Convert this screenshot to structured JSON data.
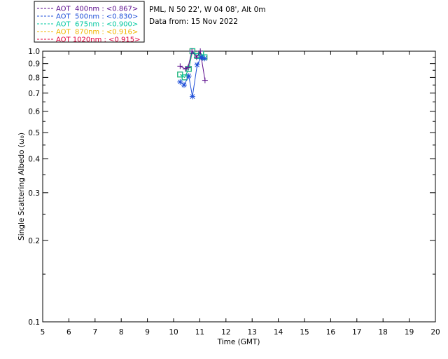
{
  "header": {
    "site_line": "PML, N 50 22', W 04 08', Alt 0m",
    "date_line": "Data from: 15 Nov 2022"
  },
  "chart_data": {
    "type": "scatter",
    "xlabel": "Time (GMT)",
    "ylabel": "Single Scattering Albedo (ω₀)",
    "xlim": [
      5,
      20
    ],
    "ylim": [
      0.1,
      1.0
    ],
    "yscale": "log",
    "x_ticks": [
      5,
      6,
      7,
      8,
      9,
      10,
      11,
      12,
      13,
      14,
      15,
      16,
      17,
      18,
      19,
      20
    ],
    "y_ticks": [
      0.1,
      0.2,
      0.3,
      0.4,
      0.5,
      0.6,
      0.7,
      0.8,
      0.9,
      1.0
    ],
    "y_tick_labels": [
      "0.1",
      "0.2",
      "0.3",
      "0.4",
      "0.5",
      "0.6",
      "0.7",
      "0.8",
      "0.9",
      "1.0"
    ],
    "legend_position": "top-left, outside plot",
    "series": [
      {
        "name": "AOT  400nm : <0.867>",
        "color": "#5a0a8c",
        "marker": "plus",
        "x": [
          10.25,
          10.45,
          10.55,
          10.7,
          10.88,
          11.02,
          11.2
        ],
        "y": [
          0.88,
          0.86,
          0.87,
          1.0,
          0.95,
          1.0,
          0.78
        ]
      },
      {
        "name": "AOT  500nm : <0.830>",
        "color": "#1f4fd8",
        "marker": "star",
        "x": [
          10.25,
          10.4,
          10.58,
          10.72,
          10.9,
          11.05,
          11.18
        ],
        "y": [
          0.77,
          0.75,
          0.81,
          0.68,
          0.89,
          0.95,
          0.94
        ]
      },
      {
        "name": "AOT  675nm : <0.900>",
        "color": "#00c8a0",
        "marker": "square",
        "x": [
          10.25,
          10.42,
          10.58,
          10.72,
          10.9,
          11.05,
          11.18
        ],
        "y": [
          0.82,
          0.8,
          0.86,
          1.0,
          0.96,
          0.98,
          0.95
        ]
      },
      {
        "name": "AOT  870nm : <0.916>",
        "color": "#f0b400",
        "marker": "square",
        "x": [
          10.25,
          10.42,
          10.58,
          10.72,
          10.9,
          11.05,
          11.18
        ],
        "y": [
          0.82,
          0.8,
          0.86,
          1.0,
          0.96,
          0.98,
          0.95
        ]
      },
      {
        "name": "AOT 1020nm : <0.915>",
        "color": "#e0003c",
        "marker": "square",
        "x": [
          10.25,
          10.42,
          10.58,
          10.72,
          10.9,
          11.05,
          11.18
        ],
        "y": [
          0.82,
          0.8,
          0.86,
          1.0,
          0.96,
          0.98,
          0.95
        ]
      }
    ]
  }
}
